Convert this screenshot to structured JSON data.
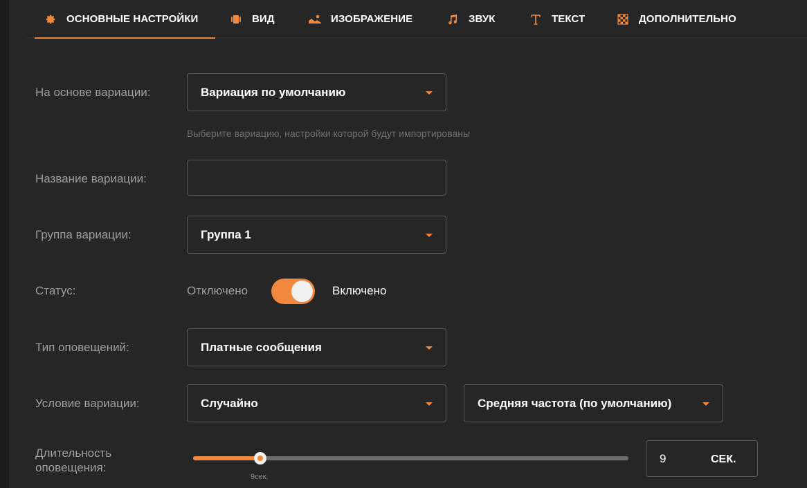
{
  "tabs": [
    {
      "label": "ОСНОВНЫЕ НАСТРОЙКИ",
      "icon": "gear-icon",
      "active": true
    },
    {
      "label": "ВИД",
      "icon": "film-icon"
    },
    {
      "label": "ИЗОБРАЖЕНИЕ",
      "icon": "image-icon"
    },
    {
      "label": "ЗВУК",
      "icon": "music-note-icon"
    },
    {
      "label": "ТЕКСТ",
      "icon": "text-icon"
    },
    {
      "label": "ДОПОЛНИТЕЛЬНО",
      "icon": "checkerboard-icon"
    }
  ],
  "form": {
    "base_variation": {
      "label": "На основе вариации:",
      "value": "Вариация по умолчанию",
      "hint": "Выберите вариацию, настройки которой будут импортированы"
    },
    "variation_name": {
      "label": "Название вариации:",
      "value": ""
    },
    "variation_group": {
      "label": "Группа вариации:",
      "value": "Группа 1"
    },
    "status": {
      "label": "Статус:",
      "off_label": "Отключено",
      "on_label": "Включено",
      "enabled": true
    },
    "notification_type": {
      "label": "Тип оповещений:",
      "value": "Платные сообщения"
    },
    "variation_condition": {
      "label": "Условие вариации:",
      "value": "Случайно",
      "frequency": "Средняя частота (по умолчанию)"
    },
    "duration": {
      "label_line1": "Длительность",
      "label_line2": "оповещения:",
      "value": "9",
      "unit": "СЕК.",
      "slider_caption": "9сек.",
      "slider_fraction": 0.155
    }
  },
  "colors": {
    "accent": "#f0883e",
    "panel": "#262626",
    "border": "#5a5a5a"
  }
}
